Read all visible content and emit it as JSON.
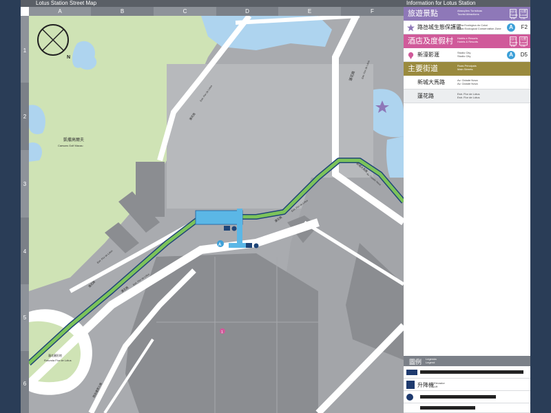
{
  "map_title": "Lotus Station Street Map",
  "panel_title": "Information for Lotus Station",
  "columns": [
    "A",
    "B",
    "C",
    "D",
    "E",
    "F"
  ],
  "rows": [
    "1",
    "2",
    "3",
    "4",
    "5",
    "6"
  ],
  "compass": {
    "label": "N",
    "icon": "compass-icon"
  },
  "map_labels": {
    "golf_zh": "凱撒高爾夫",
    "golf_en": "Caesars Golf Macau",
    "rotunda_zh": "蓮花圓形地",
    "rotunda_en": "Rotunda Flor de Lótus",
    "road_lotus_zh": "蓮花路",
    "road_lotus_en": "Estr. Flor de Lótus",
    "road_cidade_zh": "新城大馬路",
    "road_cidade_en": "Av. Cidade Nova",
    "road_lower_zh": "路氹連貫公路",
    "station_exit": "A",
    "poi_number": "1"
  },
  "sections": {
    "attractions": {
      "zh": "旅遊景點",
      "en_line1": "Atracções Turísticas",
      "en_line2": "Tourist Attractions",
      "exit_label": "出口 Saída Exit",
      "loc_label": "位置 Local. Loc.",
      "color": "#8e78b8"
    },
    "hotels": {
      "zh": "酒店及度假村",
      "en_line1": "Hotéis e Resorts",
      "en_line2": "Hotels & Resorts",
      "exit_label": "出口 Saída Exit",
      "loc_label": "位置 Local. Loc.",
      "color": "#d05a9a"
    },
    "streets": {
      "zh": "主要街道",
      "en_line1": "Ruas Principais",
      "en_line2": "Main Streets",
      "color": "#9a8a3e"
    }
  },
  "entries": {
    "attraction_1": {
      "zh": "路氹城生態保護區",
      "en_line1": "Zona Ecológica do Cotai",
      "en_line2": "Cotai Ecological Conservation Zone",
      "exit": "A",
      "grid": "F2"
    },
    "hotel_1": {
      "zh": "新濠影滙",
      "en_line1": "Studio City",
      "en_line2": "Studio City",
      "exit": "A",
      "grid": "D5"
    },
    "street_1": {
      "zh": "新城大馬路",
      "en_line1": "Av. Cidade Nova",
      "en_line2": "Av. Cidade Nova"
    },
    "street_2": {
      "zh": "蓮花路",
      "en_line1": "Estr. Flor de Lótus",
      "en_line2": "Estr. Flor de Lótus"
    }
  },
  "legend": {
    "zh": "圖例",
    "en_line1": "Legenda",
    "en_line2": "Legend",
    "lift_zh": "升降機",
    "lift_en1": "Elevador",
    "lift_en2": "Lift"
  },
  "colors": {
    "park": "#cfe3b5",
    "water": "#aed4ef",
    "building": "#8b8d91",
    "block": "#b7b9bc",
    "road": "#ffffff",
    "rail": "#7cc35a",
    "rail_edge": "#1f4578",
    "station": "#5bb7e6"
  }
}
